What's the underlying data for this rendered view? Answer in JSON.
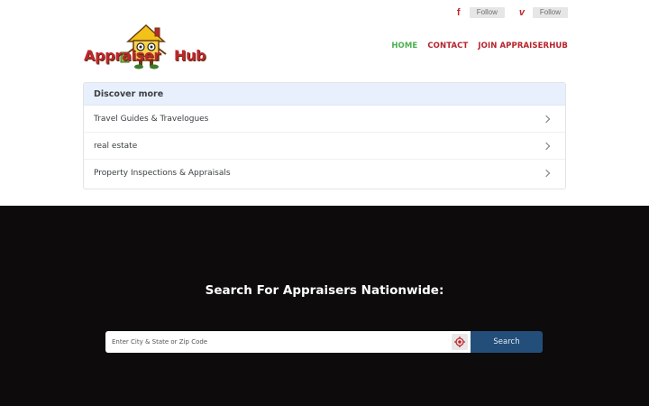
{
  "social": {
    "facebook": {
      "icon": "facebook-icon",
      "follow_label": "Follow"
    },
    "vimeo": {
      "icon": "vimeo-icon",
      "follow_label": "Follow"
    }
  },
  "logo": {
    "word1": "Appraiser",
    "word2": "Hub"
  },
  "nav": {
    "home": "HOME",
    "contact": "CONTACT",
    "join": "JOIN APPRAISERHUB"
  },
  "discover": {
    "title": "Discover more",
    "items": [
      {
        "label": "Travel Guides & Travelogues"
      },
      {
        "label": "real estate"
      },
      {
        "label": "Property Inspections & Appraisals"
      }
    ]
  },
  "hero": {
    "title": "Search For Appraisers Nationwide:",
    "search_placeholder": "Enter City & State or Zip Code",
    "search_button": "Search"
  },
  "colors": {
    "brand_red": "#c0262d",
    "home_green": "#4caf50",
    "hero_bg": "#0d0b0b",
    "search_button": "#234e7a"
  }
}
